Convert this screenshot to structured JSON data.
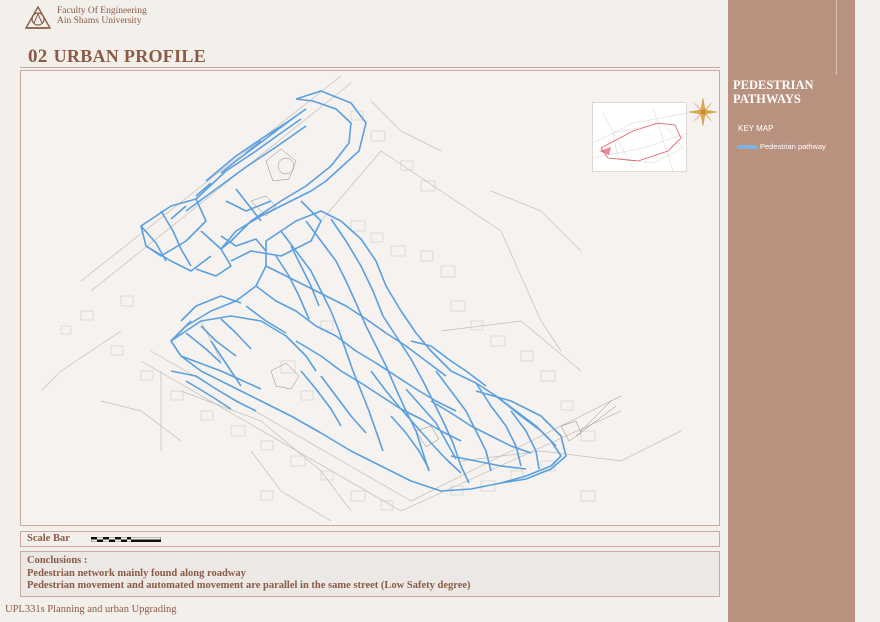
{
  "header": {
    "faculty": "Faculty Of Engineering",
    "university": "Ain Shams University"
  },
  "section": {
    "number": "02",
    "title": "URBAN PROFILE"
  },
  "sidebar": {
    "title_line1": "PEDESTRIAN",
    "title_line2": "PATHWAYS",
    "keymap_label": "KEY MAP",
    "legend_label": "Pedestrian pathway",
    "legend_color": "#7fb2e0"
  },
  "scale": {
    "label": "Scale Bar"
  },
  "conclusions": {
    "heading": "Conclusions :",
    "line1": "Pedestrian network mainly found along roadway",
    "line2": "Pedestrian movement and automated movement are parallel in the same street (Low Safety degree)"
  },
  "footer": {
    "course": "UPL331s Planning and urban Upgrading"
  },
  "colors": {
    "brand": "#8c5a44",
    "sidebar": "#b9927f",
    "path": "#5aa0e0",
    "context": "#b8b2ad"
  }
}
